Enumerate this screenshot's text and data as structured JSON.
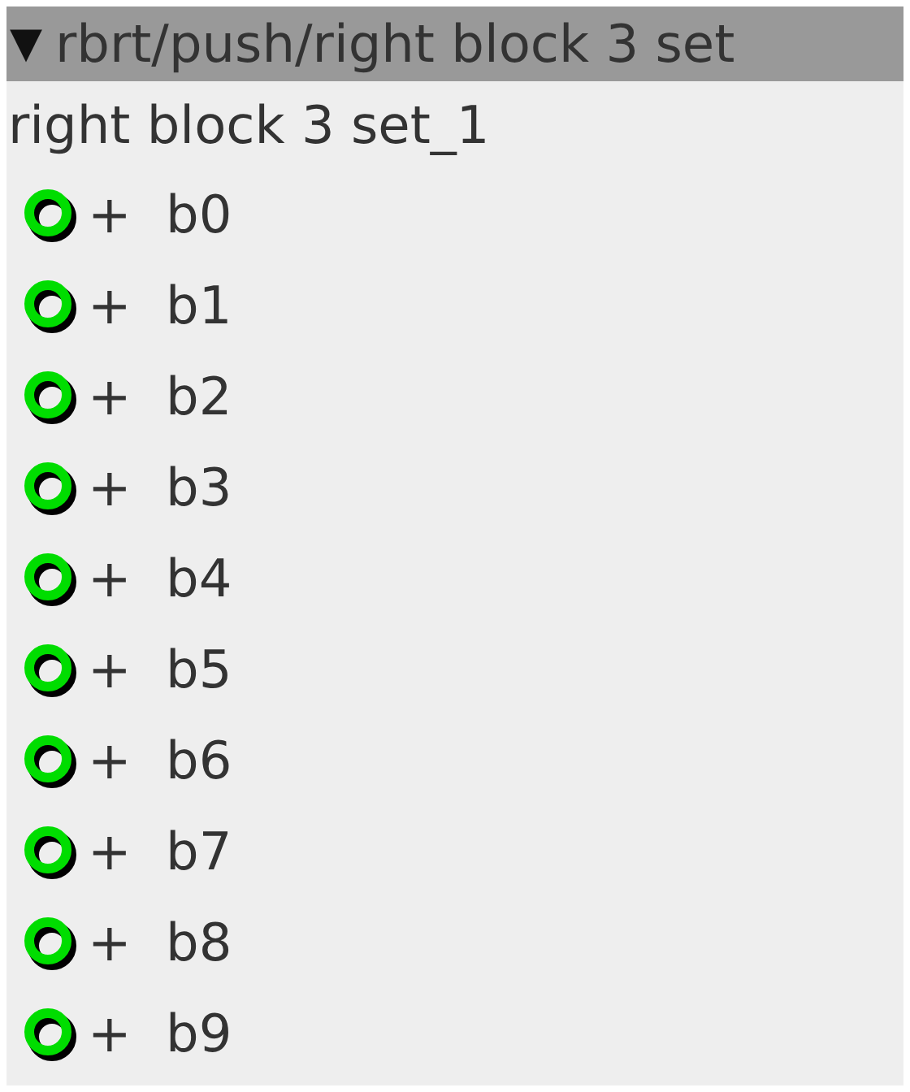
{
  "header": {
    "arrow": "▼",
    "title": "rbrt/push/right block 3 set"
  },
  "subtitle": "right block 3 set_1",
  "items": [
    {
      "expander": "+",
      "label": "b0"
    },
    {
      "expander": "+",
      "label": "b1"
    },
    {
      "expander": "+",
      "label": "b2"
    },
    {
      "expander": "+",
      "label": "b3"
    },
    {
      "expander": "+",
      "label": "b4"
    },
    {
      "expander": "+",
      "label": "b5"
    },
    {
      "expander": "+",
      "label": "b6"
    },
    {
      "expander": "+",
      "label": "b7"
    },
    {
      "expander": "+",
      "label": "b8"
    },
    {
      "expander": "+",
      "label": "b9"
    }
  ]
}
